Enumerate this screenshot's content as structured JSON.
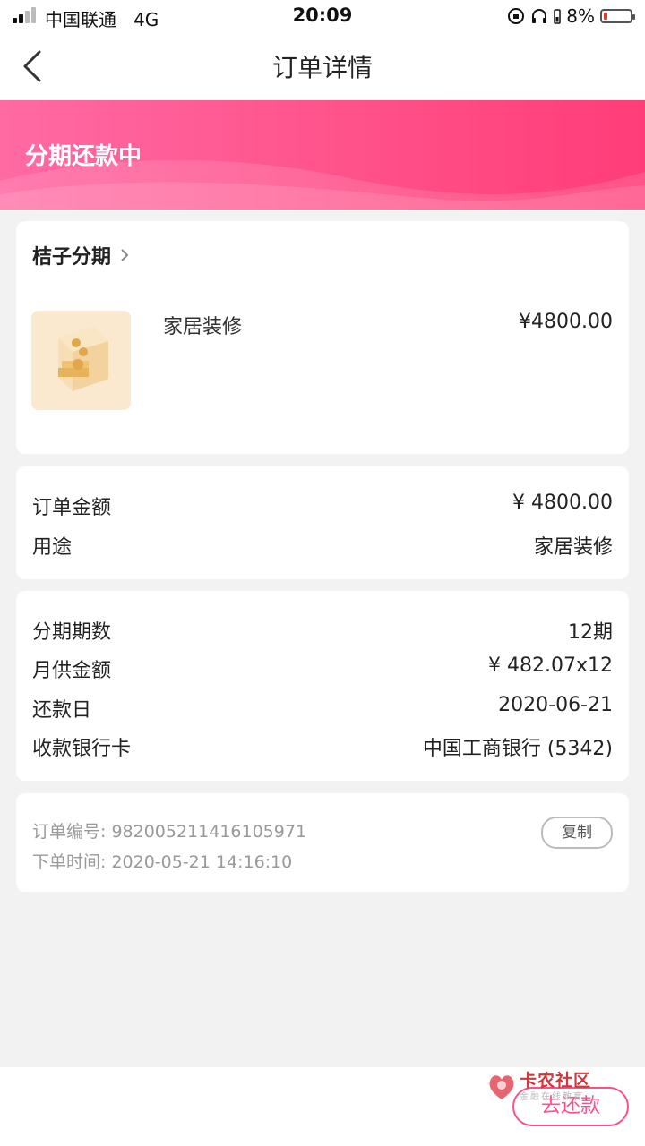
{
  "status_bar": {
    "carrier": "中国联通",
    "network": "4G",
    "time": "20:09",
    "battery": "8%",
    "battery_level": 0.08
  },
  "nav": {
    "title": "订单详情"
  },
  "banner": {
    "status": "分期还款中",
    "color": "#ff4f88"
  },
  "product": {
    "merchant": "桔子分期",
    "name": "家居装修",
    "price": "¥4800.00"
  },
  "order_summary": [
    {
      "label": "订单金额",
      "value": "¥ 4800.00"
    },
    {
      "label": "用途",
      "value": "家居装修"
    }
  ],
  "installment": [
    {
      "label": "分期期数",
      "value": "12期"
    },
    {
      "label": "月供金额",
      "value": "¥ 482.07x12"
    },
    {
      "label": "还款日",
      "value": "2020-06-21"
    },
    {
      "label": "收款银行卡",
      "value": "中国工商银行 (5342)"
    }
  ],
  "order_meta": {
    "order_no": "订单编号: 982005211416105971",
    "order_time": "下单时间: 2020-05-21 14:16:10",
    "copy_label": "复制"
  },
  "bottom": {
    "pay_label": "去还款"
  },
  "watermark": {
    "main": "卡农社区",
    "sub": "金融在线教育"
  },
  "icons": {
    "back": "chevron-left-icon",
    "merchant_arrow": "chevron-right-icon",
    "product": "coin-box-icon"
  }
}
